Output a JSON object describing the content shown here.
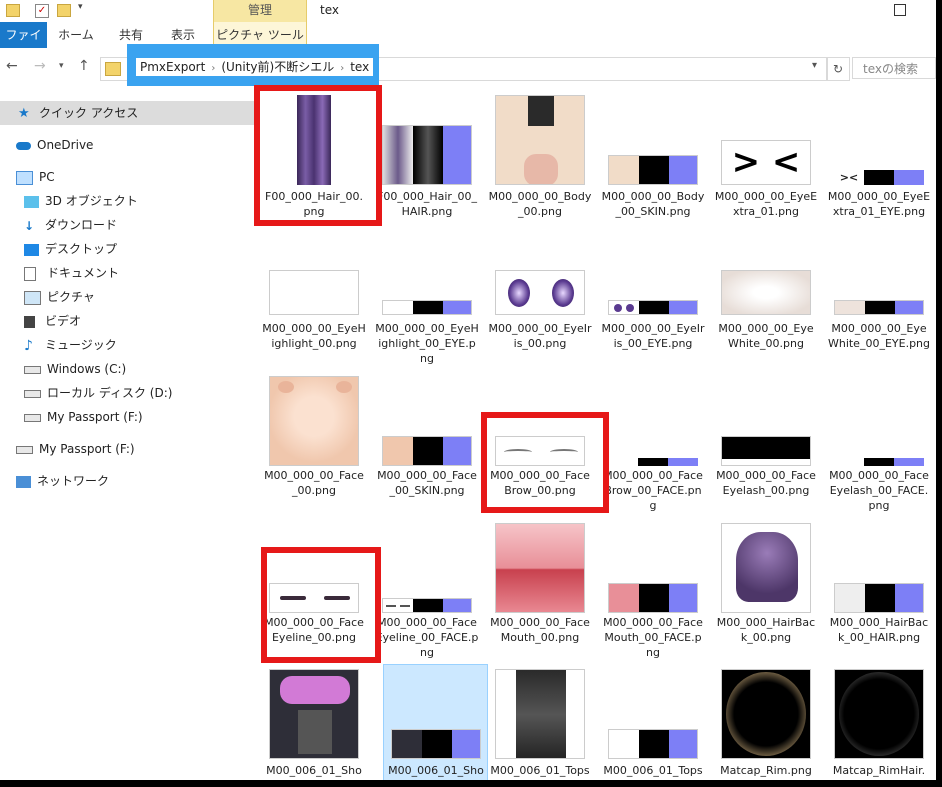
{
  "window": {
    "title": "tex",
    "context_tab_header": "管理"
  },
  "ribbon": {
    "tabs": [
      "ファイル",
      "ホーム",
      "共有",
      "表示",
      "ピクチャ ツール"
    ]
  },
  "address": {
    "path": [
      "PmxExport",
      "(Unity前)不断シエル",
      "tex"
    ],
    "search_placeholder": "texの検索"
  },
  "nav": {
    "items": [
      {
        "label": "クイック アクセス",
        "icon": "star-icon"
      },
      {
        "label": "OneDrive",
        "icon": "cloud-icon"
      },
      {
        "label": "PC",
        "icon": "computer-icon"
      },
      {
        "label": "3D オブジェクト",
        "icon": "cube-icon"
      },
      {
        "label": "ダウンロード",
        "icon": "download-icon"
      },
      {
        "label": "デスクトップ",
        "icon": "desktop-icon"
      },
      {
        "label": "ドキュメント",
        "icon": "document-icon"
      },
      {
        "label": "ピクチャ",
        "icon": "picture-icon"
      },
      {
        "label": "ビデオ",
        "icon": "video-icon"
      },
      {
        "label": "ミュージック",
        "icon": "music-icon"
      },
      {
        "label": "Windows (C:)",
        "icon": "drive-icon"
      },
      {
        "label": "ローカル ディスク (D:)",
        "icon": "drive-icon"
      },
      {
        "label": "My Passport (F:)",
        "icon": "drive-icon"
      },
      {
        "label": "My Passport (F:)",
        "icon": "drive-icon"
      },
      {
        "label": "ネットワーク",
        "icon": "network-icon"
      }
    ]
  },
  "files": [
    {
      "name": "F00_000_Hair_00.png",
      "highlighted": true
    },
    {
      "name": "F00_000_Hair_00_HAIR.png"
    },
    {
      "name": "M00_000_00_Body_00.png"
    },
    {
      "name": "M00_000_00_Body_00_SKIN.png"
    },
    {
      "name": "M00_000_00_EyeExtra_01.png"
    },
    {
      "name": "M00_000_00_EyeExtra_01_EYE.png"
    },
    {
      "name": "M00_000_00_EyeHighlight_00.png"
    },
    {
      "name": "M00_000_00_EyeHighlight_00_EYE.png"
    },
    {
      "name": "M00_000_00_EyeIris_00.png"
    },
    {
      "name": "M00_000_00_EyeIris_00_EYE.png"
    },
    {
      "name": "M00_000_00_EyeWhite_00.png"
    },
    {
      "name": "M00_000_00_EyeWhite_00_EYE.png"
    },
    {
      "name": "M00_000_00_Face_00.png"
    },
    {
      "name": "M00_000_00_Face_00_SKIN.png"
    },
    {
      "name": "M00_000_00_FaceBrow_00.png",
      "highlighted": true
    },
    {
      "name": "M00_000_00_FaceBrow_00_FACE.png"
    },
    {
      "name": "M00_000_00_FaceEyelash_00.png"
    },
    {
      "name": "M00_000_00_FaceEyelash_00_FACE.png"
    },
    {
      "name": "M00_000_00_FaceEyeline_00.png",
      "highlighted": true
    },
    {
      "name": "M00_000_00_FaceEyeline_00_FACE.png"
    },
    {
      "name": "M00_000_00_FaceMouth_00.png"
    },
    {
      "name": "M00_000_00_FaceMouth_00_FACE.png"
    },
    {
      "name": "M00_000_HairBack_00.png"
    },
    {
      "name": "M00_000_HairBack_00_HAIR.png"
    },
    {
      "name": "M00_006_01_Sho"
    },
    {
      "name": "M00_006_01_Sho",
      "selected": true
    },
    {
      "name": "M00_006_01_Tops"
    },
    {
      "name": "M00_006_01_Tops"
    },
    {
      "name": "Matcap_Rim.png"
    },
    {
      "name": "Matcap_RimHair."
    }
  ],
  "colors": {
    "accent": "#1979ca",
    "breadcrumb_highlight": "#3aa3f0",
    "annotation_red": "#e61818",
    "selection": "#cce8ff"
  }
}
